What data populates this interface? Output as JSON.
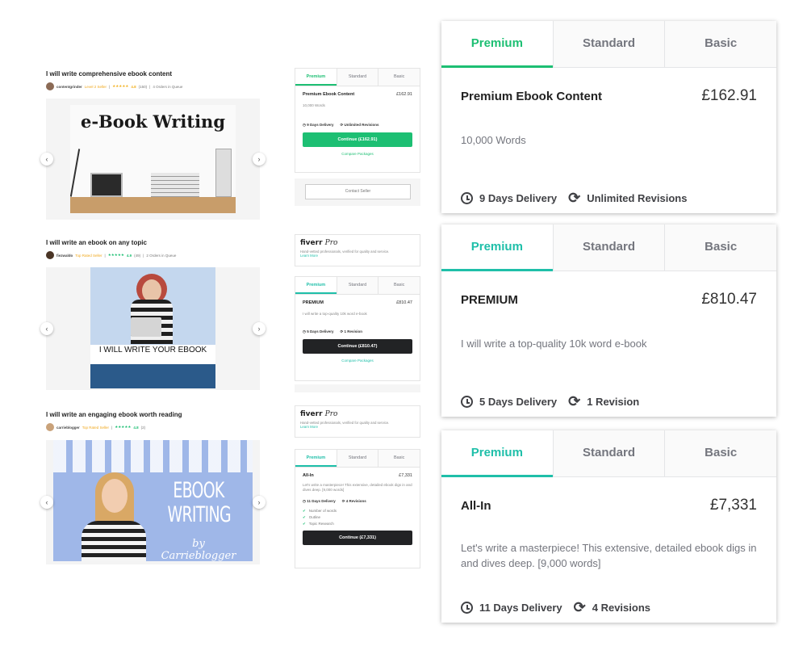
{
  "gigs": [
    {
      "title": "I will write comprehensive ebook content",
      "seller": "contentgrinder",
      "level": "Level 2 Seller",
      "stars": "★★★★★",
      "rating": "4.8",
      "reviews": "(150)",
      "queue": "4 Orders in Queue",
      "image_title": "e-Book Writing"
    },
    {
      "title": "I will write an ebook on any topic",
      "seller": "fiezwaldo",
      "level": "Top Rated Seller",
      "stars": "★★★★★",
      "rating": "4.9",
      "reviews": "(49)",
      "queue": "2 Orders in Queue",
      "image_title": "I WILL WRITE YOUR EBOOK"
    },
    {
      "title": "I will write an engaging ebook worth reading",
      "seller": "carrieblogger",
      "level": "Top Rated Seller",
      "stars": "★★★★★",
      "rating": "4.8",
      "reviews": "(2)",
      "queue": "",
      "image_title_1": "EBOOK WRITING",
      "image_title_2": "by Carrieblogger"
    }
  ],
  "tabs": [
    "Premium",
    "Standard",
    "Basic"
  ],
  "packages": [
    {
      "name": "Premium Ebook Content",
      "price": "£162.91",
      "description": "10,000 Words",
      "delivery": "9 Days Delivery",
      "revisions": "Unlimited Revisions",
      "button": "Continue (£162.91)"
    },
    {
      "name": "PREMIUM",
      "price": "£810.47",
      "description": "I will write a top-quality 10k word e-book",
      "delivery": "5 Days Delivery",
      "revisions": "1 Revision",
      "button": "Continue (£810.47)"
    },
    {
      "name": "All-In",
      "price": "£7,331",
      "description": "Let's write a masterpiece! This extensive, detailed ebook digs in and dives deep. [9,000 words]",
      "delivery": "11 Days Delivery",
      "revisions": "4 Revisions",
      "button": "Continue (£7,331)",
      "features": [
        "Number of words",
        "Outline",
        "Topic Research"
      ]
    }
  ],
  "compare_link": "Compare Packages",
  "contact_button": "Contact Seller",
  "fiverr_pro": {
    "logo": "fiverr",
    "logo_suffix": "Pro",
    "text": "Hand-vetted professionals, verified for quality and service.",
    "link": "Learn More"
  },
  "icons": {
    "prev": "chevron-left-icon",
    "next": "chevron-right-icon",
    "delivery": "clock-icon",
    "revisions": "refresh-icon",
    "check": "check-icon"
  },
  "colors": {
    "green": "#1dbf73",
    "teal": "#1fbfa9",
    "dark_button": "#222325",
    "star": "#f2b01e"
  }
}
